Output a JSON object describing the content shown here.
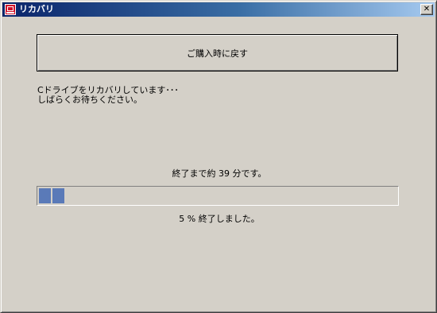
{
  "window": {
    "title": "リカバリ"
  },
  "icons": {
    "app": "recovery-app-icon",
    "close": "close-icon"
  },
  "main_button": {
    "label": "ご購入時に戻す"
  },
  "status": {
    "line1": "Cドライブをリカバリしています･･･",
    "line2": "しばらくお待ちください。"
  },
  "progress": {
    "remaining_text": "終了まで約 39 分です。",
    "percent_text": "5 % 終了しました。",
    "value_percent": 5,
    "visible_blocks": 2
  },
  "colors": {
    "titlebar_start": "#0a246a",
    "titlebar_end": "#a6caf0",
    "progress_block": "#5a7ab8",
    "background": "#d4d0c8"
  }
}
